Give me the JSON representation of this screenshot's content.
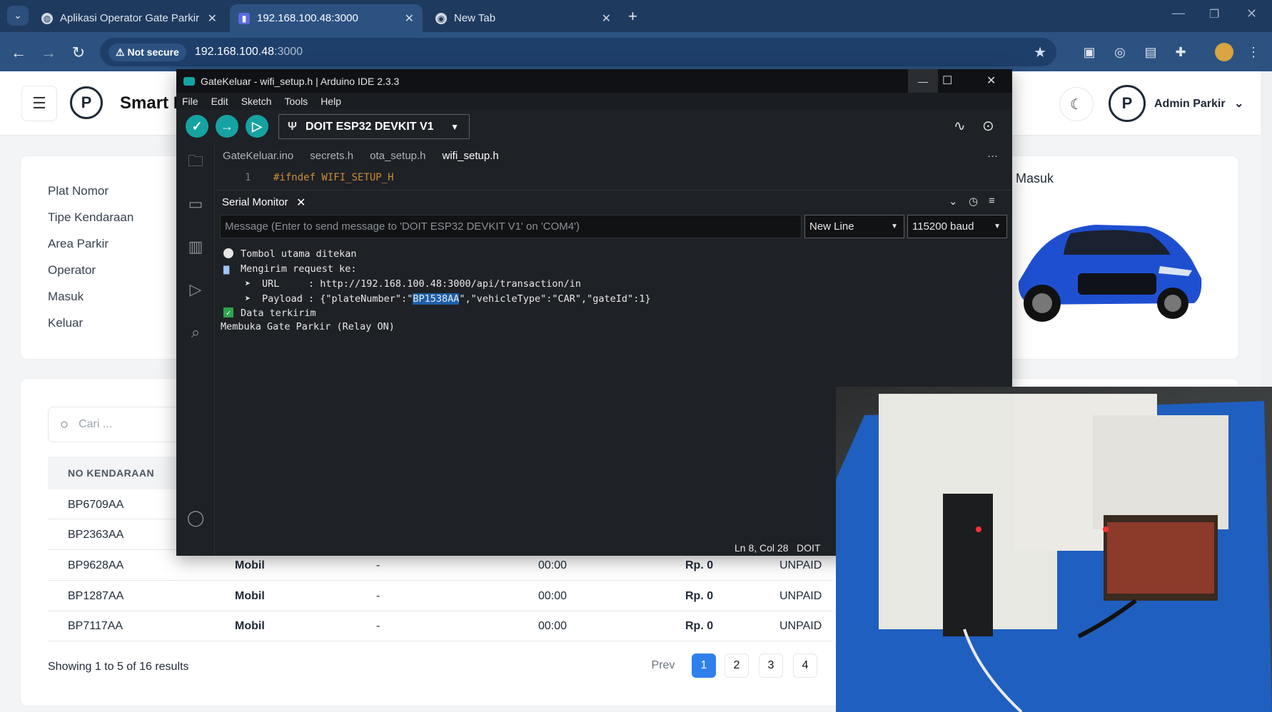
{
  "browser": {
    "tabs": [
      {
        "label": "Aplikasi Operator Gate Parkir"
      },
      {
        "label": "192.168.100.48:3000"
      },
      {
        "label": "New Tab"
      }
    ],
    "security_label": "Not secure",
    "url_host": "192.168.100.48",
    "url_port": ":3000"
  },
  "app": {
    "brand": "Smart P",
    "user_name": "Admin Parkir",
    "detail_labels": [
      "Plat Nomor",
      "Tipe Kendaraan",
      "Area Parkir",
      "Operator",
      "Masuk",
      "Keluar"
    ],
    "photo_label": "Masuk",
    "search_placeholder": "Cari ...",
    "table_header": "NO KENDARAAN",
    "rows": [
      {
        "plate": "BP6709AA"
      },
      {
        "plate": "BP2363AA"
      },
      {
        "plate": "BP9628AA",
        "type": "Mobil",
        "area": "-",
        "duration": "00:00",
        "fee": "Rp. 0",
        "status": "UNPAID"
      },
      {
        "plate": "BP1287AA",
        "type": "Mobil",
        "area": "-",
        "duration": "00:00",
        "fee": "Rp. 0",
        "status": "UNPAID"
      },
      {
        "plate": "BP7117AA",
        "type": "Mobil",
        "area": "-",
        "duration": "00:00",
        "fee": "Rp. 0",
        "status": "UNPAID"
      }
    ],
    "showing": "Showing 1 to 5 of 16 results",
    "pagination": {
      "prev": "Prev",
      "pages": [
        "1",
        "2",
        "3",
        "4"
      ]
    }
  },
  "ide": {
    "title": "GateKeluar - wifi_setup.h | Arduino IDE 2.3.3",
    "menu": [
      "File",
      "Edit",
      "Sketch",
      "Tools",
      "Help"
    ],
    "board": "DOIT ESP32 DEVKIT V1",
    "file_tabs": [
      "GateKeluar.ino",
      "secrets.h",
      "ota_setup.h",
      "wifi_setup.h"
    ],
    "code_line_no": "1",
    "code_line": "#ifndef WIFI_SETUP_H",
    "serial_title": "Serial Monitor",
    "serial_placeholder": "Message (Enter to send message to 'DOIT ESP32 DEVKIT V1' on 'COM4')",
    "line_ending": "New Line",
    "baud": "115200 baud",
    "output": {
      "l1": "Tombol utama ditekan",
      "l2": "Mengirim request ke:",
      "l3": "URL     : http://192.168.100.48:3000/api/transaction/in",
      "l4a": "Payload : {\"plateNumber\":\"",
      "l4b": "BP1538AA",
      "l4c": "\",\"vehicleType\":\"CAR\",\"gateId\":1}",
      "l5": "Data terkirim",
      "l6": "Membuka Gate Parkir (Relay ON)"
    },
    "status_pos": "Ln 8, Col 28",
    "status_board": "DOIT"
  }
}
